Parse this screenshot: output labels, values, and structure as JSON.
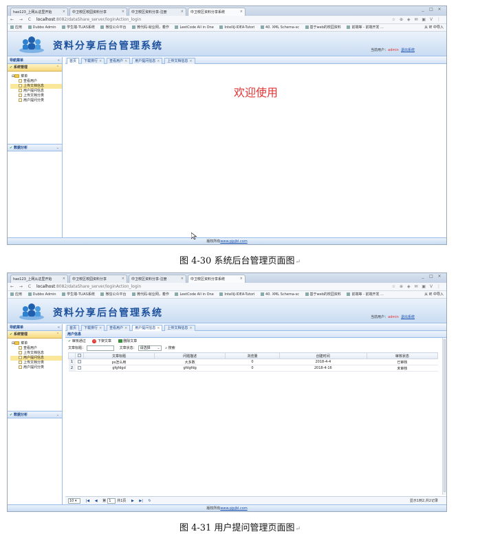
{
  "browser": {
    "tabs": [
      {
        "label": "hao123_上网从这里开始",
        "active": false
      },
      {
        "label": "中卫校区校园资料分享",
        "active": false
      },
      {
        "label": "中卫校区资料分享-注册",
        "active": false
      },
      {
        "label": "中卫校区资料分享系统",
        "active": true
      }
    ],
    "tab_close": "×",
    "window_controls": [
      "_",
      "□",
      "×"
    ],
    "nav_arrows": "← → C",
    "url_host": "localhost",
    "url_path": ":8082/dataShare_server/loginAction_login",
    "addr_icons": "☆ ⊕ ◈ ✉ ▣ V ⋮",
    "bookmarks": [
      "应用",
      "Dubbo Admin",
      "学生端-TLIAS系统",
      "微信公众平台",
      "微代码-就业网，着作",
      "LeetCode All in One",
      "IntelliJ-IDEA-Tutori",
      "40. XML Schema-sc",
      "基于web的校园资料",
      "前端等 - 前端开发 ..."
    ],
    "bookmark_right": "从 IE 中导入"
  },
  "app": {
    "title": "资料分享后台管理系统",
    "welcome_label": "当前用户：",
    "username": "admin",
    "logout": "退出系统"
  },
  "sidebar": {
    "header": "导航菜单",
    "header_tool": "«",
    "accordion_active": "系统管理",
    "accordion_active_tool": "⌃",
    "tree_root": "菜单",
    "tree_items": [
      "查看用户",
      "上传文档信息",
      "用户提问信息",
      "上传文档分类",
      "用户提问分类"
    ],
    "accordion_other": "数据分析",
    "accordion_other_tool": "⌄"
  },
  "screen1": {
    "tabs": [
      "首页",
      "下载排行",
      "查看用户",
      "用户提问信息",
      "上传文档信息"
    ],
    "welcome": "欢迎使用",
    "selected_tree_index": 1
  },
  "screen2": {
    "tabs": [
      "首页",
      "下载排行",
      "查看用户",
      "用户提问信息",
      "上传文档信息"
    ],
    "selected_tree_index": 2,
    "panel_title": "用户信息",
    "toolbar": {
      "review": "审核通过",
      "delete": "下架文章",
      "remove": "删除文章"
    },
    "search": {
      "title_label": "文章标题：",
      "status_label": "文章状态：",
      "status_value": "请选择",
      "search_button": "搜索"
    },
    "columns": [
      "文章标题",
      "问题描述",
      "浏览量",
      "创建时间",
      "审核状态"
    ],
    "rows": [
      {
        "n": "1",
        "title": "ps怎么用",
        "desc": "大多数",
        "views": "0",
        "created": "2018-4-4",
        "status": "已审核"
      },
      {
        "n": "2",
        "title": "gfgfdgd",
        "desc": "gfdgfdg",
        "views": "0",
        "created": "2018-4-16",
        "status": "未审核"
      }
    ],
    "pager": {
      "page_size": "10",
      "page_label": "第",
      "page_value": "1",
      "of_pages": "共1页",
      "summary": "显示1到2,共2记录"
    }
  },
  "footer": {
    "prefix": "版权所有",
    "link": "www.pjpjbl.com"
  },
  "captions": [
    "图 4-30  系统后台管理页面图",
    "图 4-31  用户提问管理页面图"
  ]
}
